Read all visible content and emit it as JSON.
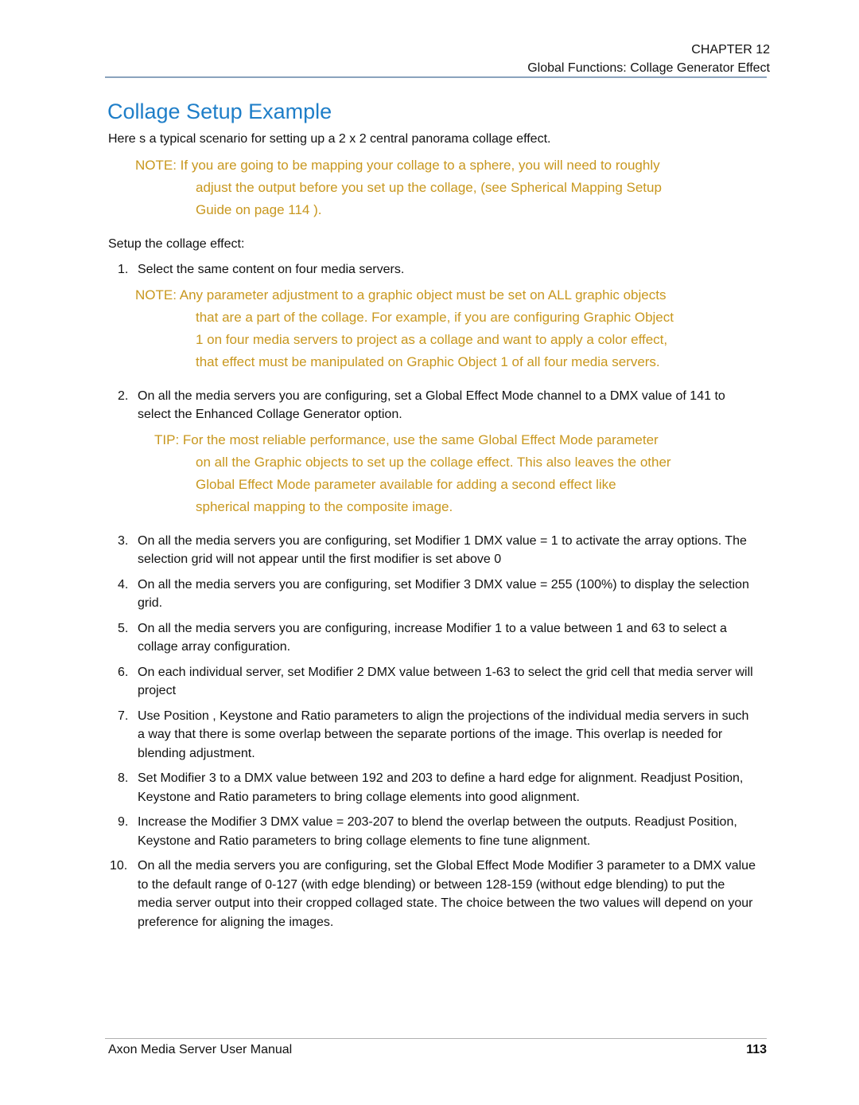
{
  "header": {
    "chapter": "CHAPTER 12",
    "section": "Global Functions: Collage Generator  Effect"
  },
  "title": "Collage Setup Example",
  "intro": "Here s a typical scenario for setting up a 2 x 2 central panorama collage effect.",
  "note1": "NOTE: If you are going to be mapping your collage to a sphere, you will need to roughly adjust the output before you set up the collage, (see Spherical Mapping Setup Guide on page 114 ).",
  "lead": "Setup the collage effect:",
  "steps": [
    {
      "num": "1.",
      "text": "Select the same content on four media servers."
    },
    {
      "num": "2.",
      "text": "On all the media servers you are configuring, set a Global Effect Mode channel to a DMX value of 141 to select the Enhanced Collage Generator option."
    },
    {
      "num": "3.",
      "text": "On all the media servers you are configuring, set Modifier 1 DMX value = 1 to activate the array options. The selection grid will not appear until the first modifier is set above 0"
    },
    {
      "num": "4.",
      "text": "On all the media servers you are configuring, set Modifier 3 DMX value = 255 (100%) to display the selection grid."
    },
    {
      "num": "5.",
      "text": "On all the media servers you are configuring, increase Modifier 1 to a value between 1 and 63 to select a collage array configuration."
    },
    {
      "num": "6.",
      "text": "On each individual server, set Modifier 2 DMX value between 1-63 to select the grid cell that media server will project"
    },
    {
      "num": "7.",
      "text": "Use Position , Keystone and Ratio parameters to align the projections of the individual media servers in such a way that there is some overlap between the separate portions of the image. This overlap is needed for blending adjustment."
    },
    {
      "num": "8.",
      "text": "Set Modifier 3 to a DMX value between 192 and 203 to define a hard edge for alignment. Readjust Position, Keystone and Ratio parameters to bring collage elements into good alignment."
    },
    {
      "num": "9.",
      "text": "Increase the Modifier 3 DMX value = 203-207 to blend the overlap between the outputs. Readjust Position, Keystone and Ratio parameters to bring collage elements to fine tune alignment."
    },
    {
      "num": "10.",
      "text": "On all the media servers you are configuring, set the Global Effect Mode Modifier 3 parameter to a DMX value to the default range of 0-127 (with edge blending) or between 128-159 (without edge blending) to put the media server output into their cropped collaged state. The choice between the two values will depend on your preference for aligning the images."
    }
  ],
  "note2": "NOTE: Any parameter adjustment to a graphic object must be set on ALL graphic objects that are a part of the collage. For example, if you are configuring Graphic Object 1 on four media servers to project as a collage and want to apply a color effect, that effect must be manipulated on Graphic Object 1 of all four media servers.",
  "tip": "TIP: For the most reliable performance, use the same Global Effect Mode parameter on all the Graphic objects to set up the collage effect. This also leaves the other Global Effect Mode parameter available for adding a second effect like spherical mapping to the composite image.",
  "footer": {
    "manual": "Axon Media Server User Manual",
    "page": "113"
  },
  "colors": {
    "title": "#1e7ec8",
    "note": "#c8971e",
    "rule": "#8aa3bd"
  }
}
